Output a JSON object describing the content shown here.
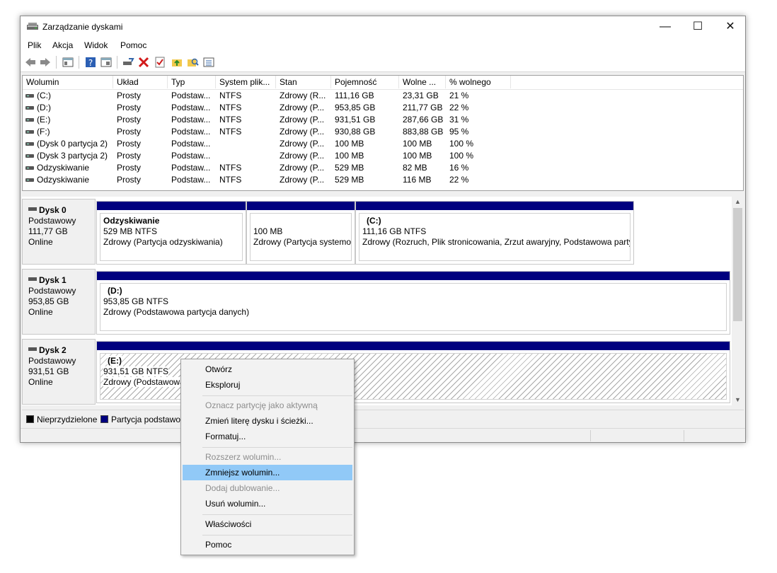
{
  "window": {
    "title": "Zarządzanie dyskami"
  },
  "menu": [
    "Plik",
    "Akcja",
    "Widok",
    "Pomoc"
  ],
  "volume_table": {
    "columns": [
      "Wolumin",
      "Układ",
      "Typ",
      "System plik...",
      "Stan",
      "Pojemność",
      "Wolne ...",
      "% wolnego"
    ],
    "rows": [
      [
        "(C:)",
        "Prosty",
        "Podstaw...",
        "NTFS",
        "Zdrowy (R...",
        "111,16 GB",
        "23,31 GB",
        "21 %"
      ],
      [
        "(D:)",
        "Prosty",
        "Podstaw...",
        "NTFS",
        "Zdrowy (P...",
        "953,85 GB",
        "211,77 GB",
        "22 %"
      ],
      [
        "(E:)",
        "Prosty",
        "Podstaw...",
        "NTFS",
        "Zdrowy (P...",
        "931,51 GB",
        "287,66 GB",
        "31 %"
      ],
      [
        "(F:)",
        "Prosty",
        "Podstaw...",
        "NTFS",
        "Zdrowy (P...",
        "930,88 GB",
        "883,88 GB",
        "95 %"
      ],
      [
        "(Dysk 0 partycja 2)",
        "Prosty",
        "Podstaw...",
        "",
        "Zdrowy (P...",
        "100 MB",
        "100 MB",
        "100 %"
      ],
      [
        "(Dysk 3 partycja 2)",
        "Prosty",
        "Podstaw...",
        "",
        "Zdrowy (P...",
        "100 MB",
        "100 MB",
        "100 %"
      ],
      [
        "Odzyskiwanie",
        "Prosty",
        "Podstaw...",
        "NTFS",
        "Zdrowy (P...",
        "529 MB",
        "82 MB",
        "16 %"
      ],
      [
        "Odzyskiwanie",
        "Prosty",
        "Podstaw...",
        "NTFS",
        "Zdrowy (P...",
        "529 MB",
        "116 MB",
        "22 %"
      ]
    ]
  },
  "disks": {
    "d0": {
      "name": "Dysk 0",
      "type": "Podstawowy",
      "size": "111,77 GB",
      "status": "Online",
      "p1": {
        "name": "Odzyskiwanie",
        "size": "529 MB NTFS",
        "state": "Zdrowy (Partycja odzyskiwania)"
      },
      "p2": {
        "size": "100 MB",
        "state": "Zdrowy (Partycja systemowa"
      },
      "p3": {
        "name": "(C:)",
        "size": "111,16 GB NTFS",
        "state": "Zdrowy (Rozruch, Plik stronicowania, Zrzut awaryjny, Podstawowa party"
      }
    },
    "d1": {
      "name": "Dysk 1",
      "type": "Podstawowy",
      "size": "953,85 GB",
      "status": "Online",
      "p1": {
        "name": "(D:)",
        "size": "953,85 GB NTFS",
        "state": "Zdrowy (Podstawowa partycja danych)"
      }
    },
    "d2": {
      "name": "Dysk 2",
      "type": "Podstawowy",
      "size": "931,51 GB",
      "status": "Online",
      "p1": {
        "name": "(E:)",
        "size": "931,51 GB NTFS",
        "state": "Zdrowy (Podstawowa"
      }
    }
  },
  "legend": {
    "unallocated": "Nieprzydzielone",
    "primary": "Partycja podstawo"
  },
  "context_menu": {
    "open": "Otwórz",
    "explore": "Eksploruj",
    "mark_active": "Oznacz partycję jako aktywną",
    "change_letter": "Zmień literę dysku i ścieżki...",
    "format": "Formatuj...",
    "extend": "Rozszerz wolumin...",
    "shrink": "Zmniejsz wolumin...",
    "add_mirror": "Dodaj dublowanie...",
    "delete": "Usuń wolumin...",
    "properties": "Właściwości",
    "help": "Pomoc"
  },
  "colors": {
    "primary_partition": "#00007f",
    "highlight": "#91c9f7",
    "unallocated": "#000000"
  }
}
